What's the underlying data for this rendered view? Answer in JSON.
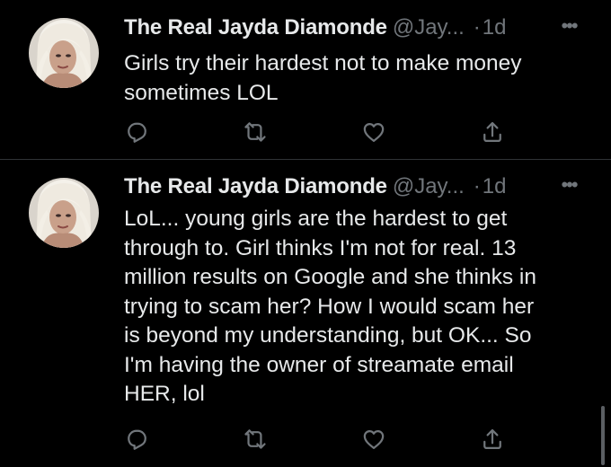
{
  "tweets": [
    {
      "author_name": "The Real Jayda Diamonde",
      "handle": "@Jay...",
      "separator": "·",
      "time": "1d",
      "more_icon": "more-horizontal-icon",
      "text": "Girls try their hardest not to make money\nsometimes LOL",
      "actions": [
        "reply-icon",
        "retweet-icon",
        "like-icon",
        "share-icon"
      ]
    },
    {
      "author_name": "The Real Jayda Diamonde",
      "handle": "@Jay...",
      "separator": "·",
      "time": "1d",
      "more_icon": "more-horizontal-icon",
      "text": "LoL... young girls are the hardest to get\nthrough to. Girl thinks I'm not for real. 13\nmillion results on Google and she thinks in\ntrying to scam her? How I would scam her\nis beyond my understanding, but OK... So\nI'm having the owner of streamate email\nHER, lol",
      "actions": [
        "reply-icon",
        "retweet-icon",
        "like-icon",
        "share-icon"
      ]
    }
  ],
  "colors": {
    "background": "#000000",
    "primary_text": "#e7e9ea",
    "secondary_text": "#71767b",
    "divider": "#2f3336"
  }
}
